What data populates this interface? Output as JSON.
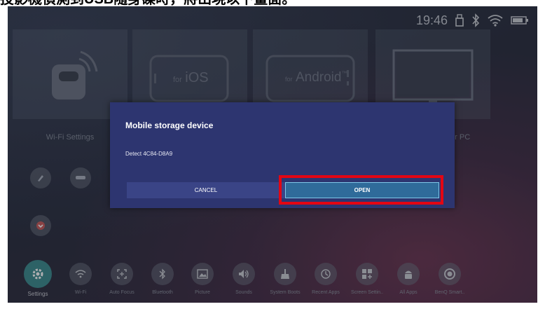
{
  "caption": "投影機偵測到USB隨身碟時，將出現以下畫面。",
  "status": {
    "time": "19:46",
    "icons": [
      "usb-icon",
      "bluetooth-icon",
      "wifi-icon",
      "battery-icon"
    ]
  },
  "tiles": [
    {
      "label": "Wi-Fi Settings",
      "icon": "wifi-projector-icon"
    },
    {
      "label": "",
      "icon": "ios-phone-icon",
      "text": "for iOS",
      "prefix": "for",
      "main": "iOS"
    },
    {
      "label": "",
      "icon": "android-phone-icon",
      "prefix": "for",
      "main": "Android",
      "tm": "™"
    },
    {
      "label": "for PC",
      "icon": "monitor-icon"
    }
  ],
  "dialog": {
    "title": "Mobile storage device",
    "message": "Detect 4C84-D8A9",
    "cancel": "CANCEL",
    "open": "OPEN"
  },
  "dock": [
    {
      "label": "Settings",
      "icon": "gear-icon",
      "active": true
    },
    {
      "label": "Wi-Fi",
      "icon": "wifi-icon"
    },
    {
      "label": "Auto Focus",
      "icon": "focus-icon"
    },
    {
      "label": "Bluetooth",
      "icon": "bluetooth-icon"
    },
    {
      "label": "Picture",
      "icon": "picture-icon"
    },
    {
      "label": "Sounds",
      "icon": "speaker-icon"
    },
    {
      "label": "System Boots",
      "icon": "broom-icon"
    },
    {
      "label": "Recent Apps",
      "icon": "history-icon"
    },
    {
      "label": "Screen Settin..",
      "icon": "screen-settings-icon"
    },
    {
      "label": "All Apps",
      "icon": "android-icon"
    },
    {
      "label": "BenQ Smart..",
      "icon": "benq-icon"
    }
  ],
  "colors": {
    "dialog_bg": "#2d3570",
    "open_button": "#2f6b9a",
    "highlight": "#e30613",
    "active_dock": "#3b8a8e"
  }
}
